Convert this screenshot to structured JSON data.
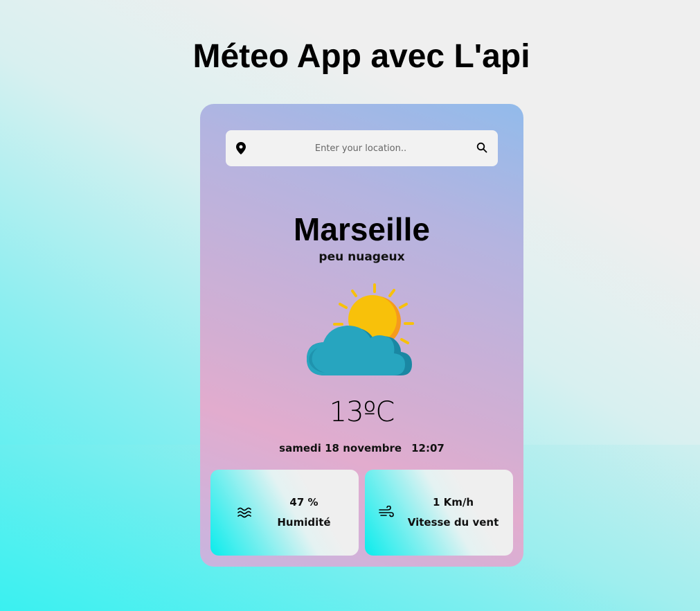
{
  "app": {
    "title": "Méteo App avec L'api"
  },
  "search": {
    "placeholder": "Enter your location..",
    "value": "",
    "location_icon": "map-pin-icon",
    "search_icon": "search-icon"
  },
  "weather": {
    "city": "Marseille",
    "description": "peu nuageux",
    "icon": "partly-cloudy-icon",
    "temperature": "13ºC",
    "date": "samedi 18 novembre",
    "time": "12:07"
  },
  "details": {
    "humidity": {
      "value": "47 %",
      "label": "Humidité",
      "icon": "water-waves-icon"
    },
    "wind": {
      "value": "1 Km/h",
      "label": "Vitesse du vent",
      "icon": "wind-icon"
    }
  },
  "colors": {
    "sun": "#f8c10a",
    "sun_shade": "#f59a1e",
    "cloud": "#27a5bf",
    "cloud_shade": "#1a87a3",
    "accent_cyan": "#0aecec"
  }
}
